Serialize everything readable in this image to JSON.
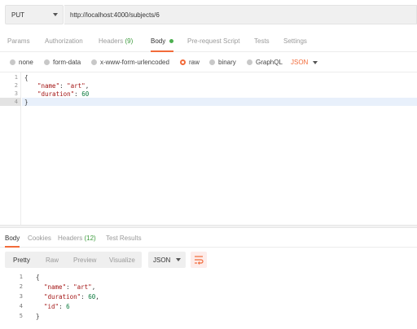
{
  "request": {
    "method": "PUT",
    "url": "http://localhost:4000/subjects/6"
  },
  "request_tabs": {
    "params": "Params",
    "authorization": "Authorization",
    "headers": "Headers",
    "headers_count": "(9)",
    "body": "Body",
    "prerequest": "Pre-request Script",
    "tests": "Tests",
    "settings": "Settings"
  },
  "body_types": {
    "none": "none",
    "form_data": "form-data",
    "urlencoded": "x-www-form-urlencoded",
    "raw": "raw",
    "binary": "binary",
    "graphql": "GraphQL",
    "format": "JSON",
    "selected": "raw"
  },
  "request_editor": {
    "lines": [
      {
        "num": "1",
        "text": "{"
      },
      {
        "num": "2",
        "key": "\"name\"",
        "sep": ": ",
        "val": "\"art\"",
        "end": ","
      },
      {
        "num": "3",
        "key": "\"duration\"",
        "sep": ": ",
        "val": "60",
        "end": ""
      },
      {
        "num": "4",
        "text": "}"
      }
    ]
  },
  "response_tabs": {
    "body": "Body",
    "cookies": "Cookies",
    "headers": "Headers",
    "headers_count": "(12)",
    "test_results": "Test Results"
  },
  "response_toolbar": {
    "pretty": "Pretty",
    "raw": "Raw",
    "preview": "Preview",
    "visualize": "Visualize",
    "format": "JSON"
  },
  "response_body": {
    "lines": [
      {
        "num": "1",
        "text": "{"
      },
      {
        "num": "2",
        "key": "\"name\"",
        "sep": ": ",
        "val": "\"art\"",
        "end": ","
      },
      {
        "num": "3",
        "key": "\"duration\"",
        "sep": ": ",
        "val": "60",
        "end": ","
      },
      {
        "num": "4",
        "key": "\"id\"",
        "sep": ": ",
        "val": "6",
        "end": ""
      },
      {
        "num": "5",
        "text": "}"
      }
    ]
  },
  "colors": {
    "accent": "#f26b3a",
    "active_dot": "#4caf50",
    "string": "#a31515",
    "number": "#0b7a3e"
  }
}
